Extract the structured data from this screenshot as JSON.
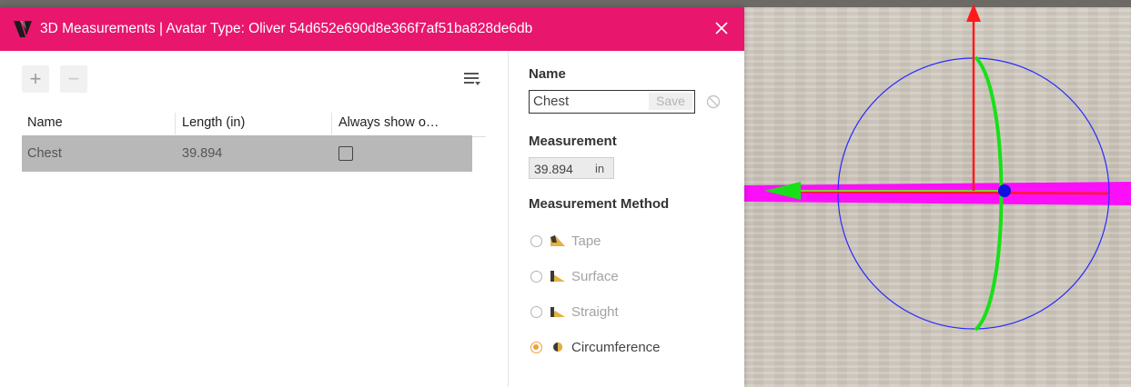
{
  "window": {
    "title": "3D Measurements | Avatar Type: Oliver 54d652e690d8e366f7af51ba828de6db",
    "close_icon": "close-icon",
    "logo_icon": "app-logo",
    "accent_color": "#e8166d"
  },
  "toolbar": {
    "add_label": "+",
    "remove_label": "−",
    "columns_icon": "column-options-icon"
  },
  "table": {
    "columns": [
      "Name",
      "Length (in)",
      "Always show o…"
    ],
    "rows": [
      {
        "name": "Chest",
        "length": "39.894",
        "always_show": false
      }
    ]
  },
  "details": {
    "name_label": "Name",
    "name_value": "Chest",
    "save_label": "Save",
    "measurement_label": "Measurement",
    "measurement_value": "39.894",
    "measurement_unit": "in",
    "method_label": "Measurement Method",
    "methods": [
      {
        "label": "Tape",
        "selected": false
      },
      {
        "label": "Surface",
        "selected": false
      },
      {
        "label": "Straight",
        "selected": false
      },
      {
        "label": "Circumference",
        "selected": true
      }
    ],
    "selected_color": "#f0a036"
  },
  "viewport": {
    "axis_colors": {
      "x": "#ff2020",
      "y": "#ff1a1a",
      "ring": "#2a2aff",
      "green_arc": "#18e018",
      "band": "#ff00ff"
    }
  }
}
